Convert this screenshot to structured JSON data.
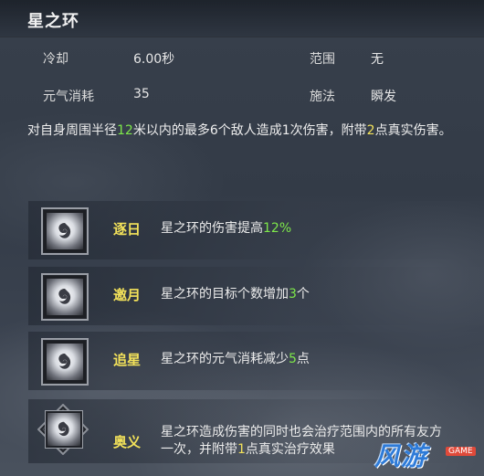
{
  "skill": {
    "title": "星之环",
    "stats": {
      "cooldown_label": "冷却",
      "cooldown_value": "6.00秒",
      "range_label": "范围",
      "range_value": "无",
      "energy_label": "元气消耗",
      "energy_value": "35",
      "cast_label": "施法",
      "cast_value": "瞬发"
    },
    "description": {
      "p1": "对自身周围半径",
      "radius": "12",
      "p2": "米以内的最多6个敌人造成1次伤害，附带",
      "true_damage": "2",
      "p3": "点真实伤害。"
    }
  },
  "upgrades": [
    {
      "name": "逐日",
      "text_prefix": "星之环的伤害提高",
      "highlight": "12%",
      "text_suffix": "",
      "icon": "star-ring-icon"
    },
    {
      "name": "邀月",
      "text_prefix": "星之环的目标个数增加",
      "highlight": "3",
      "text_suffix": "个",
      "icon": "star-ring-icon"
    },
    {
      "name": "追星",
      "text_prefix": "星之环的元气消耗减少",
      "highlight": "5",
      "text_suffix": "点",
      "icon": "star-ring-icon"
    },
    {
      "name": "奥义",
      "line1": "星之环造成伤害的同时也会治疗范围内的所有友方",
      "line2_prefix": "一次，并附带",
      "highlight": "1",
      "line2_suffix": "点真实治疗效果",
      "icon": "star-ring-icon"
    }
  ],
  "watermark": {
    "text": "风游",
    "badge": "GAME"
  },
  "colors": {
    "highlight_green": "#7ee84a",
    "upgrade_name_yellow": "#f3e25a"
  }
}
